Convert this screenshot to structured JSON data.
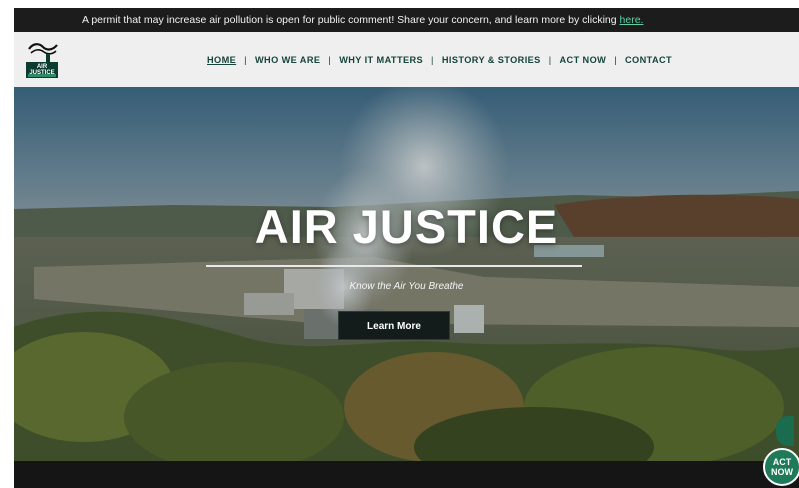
{
  "announcement": {
    "message": "A permit that may increase air pollution is open for public comment! Share your concern, and learn more by clicking ",
    "link_text": "here."
  },
  "logo": {
    "icon": "factory-smokestack-icon",
    "text": "AIR JUSTICE"
  },
  "nav": {
    "items": [
      {
        "label": "HOME",
        "active": true
      },
      {
        "label": "WHO WE ARE"
      },
      {
        "label": "WHY IT MATTERS"
      },
      {
        "label": "HISTORY & STORIES"
      },
      {
        "label": "ACT NOW"
      },
      {
        "label": "CONTACT"
      }
    ],
    "separator": "|"
  },
  "hero": {
    "title": "AIR JUSTICE",
    "tagline": "Know the Air You Breathe",
    "button_label": "Learn More",
    "image": "aerial-power-plant-photo"
  },
  "floating": {
    "act_now_line1": "ACT",
    "act_now_line2": "NOW"
  },
  "colors": {
    "brand_green": "#16443a",
    "accent_green": "#1f7a59",
    "link_green": "#5fd0a6",
    "dark_bar": "#1c1c1c"
  }
}
